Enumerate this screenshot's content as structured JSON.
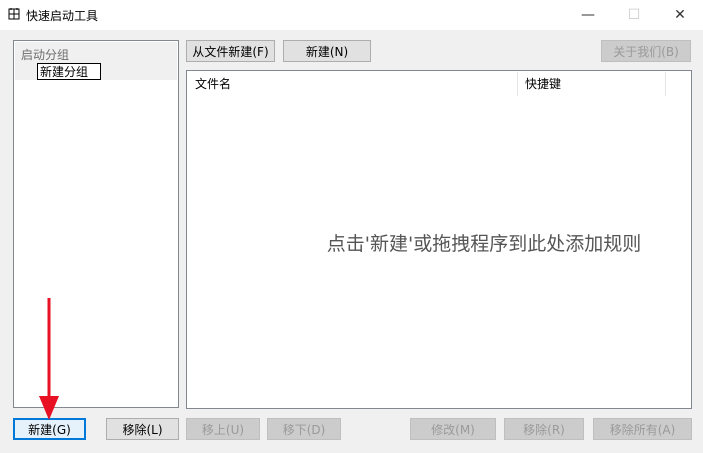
{
  "window": {
    "title": "快速启动工具",
    "minimize_glyph": "—",
    "maximize_glyph": "☐",
    "close_glyph": "✕"
  },
  "groups": {
    "header": "启动分组",
    "edit_value": "新建分组"
  },
  "toolbar": {
    "new_from_file": "从文件新建(F)",
    "new": "新建(N)",
    "about": "关于我们(B)"
  },
  "rules": {
    "columns": [
      "文件名",
      "快捷键"
    ],
    "empty_hint": "点击'新建'或拖拽程序到此处添加规则"
  },
  "bottom_bar": {
    "new_group": "新建(G)",
    "remove_group": "移除(L)",
    "move_up": "移上(U)",
    "move_down": "移下(D)",
    "modify": "修改(M)",
    "remove": "移除(R)",
    "remove_all": "移除所有(A)"
  },
  "colors": {
    "annotation_arrow": "#e81123",
    "default_button_border": "#0078d7"
  },
  "icons": {
    "app": "grid-app-icon",
    "arrow": "red-down-arrow-annotation"
  }
}
